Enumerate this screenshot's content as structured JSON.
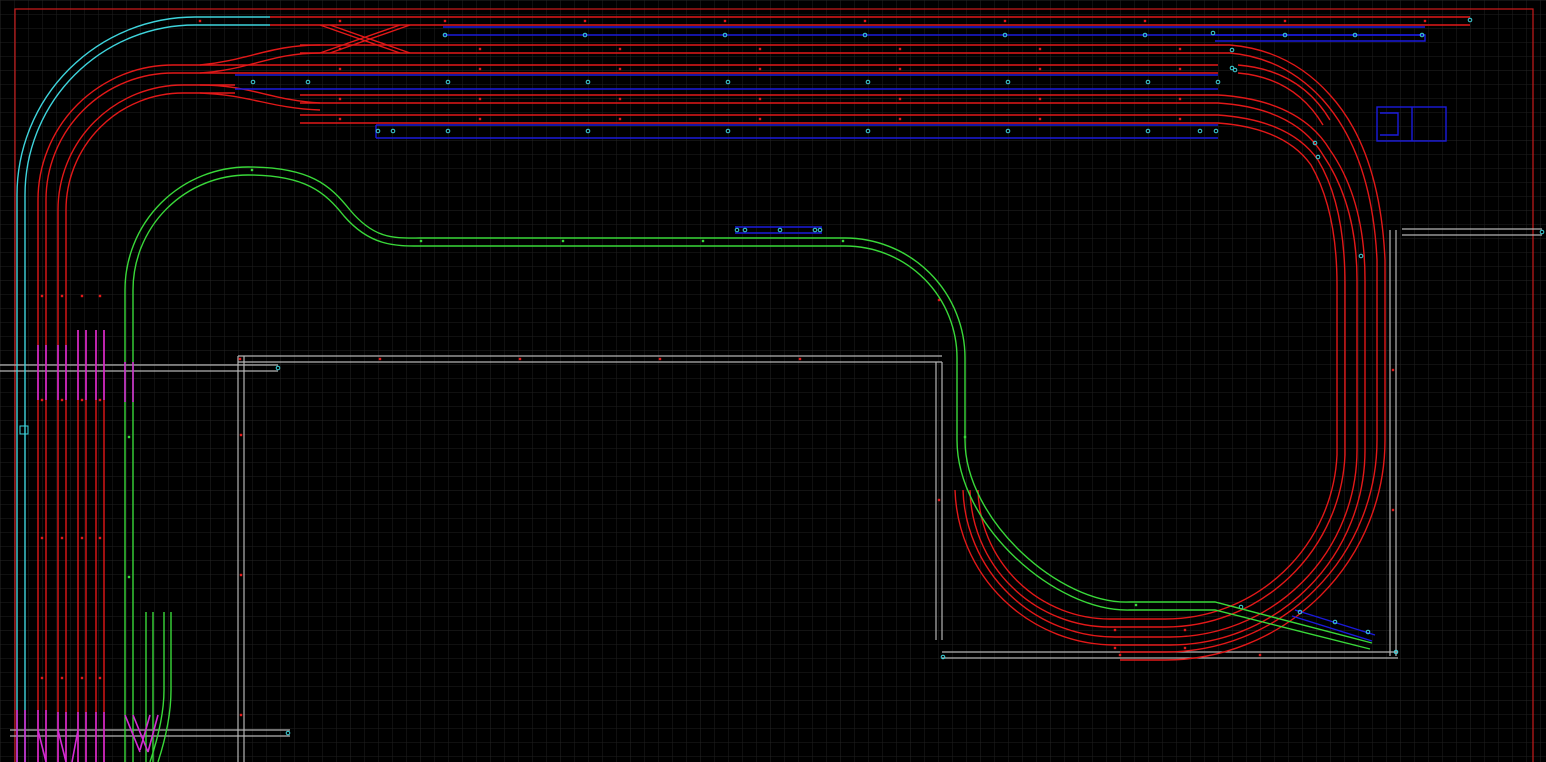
{
  "app": {
    "view": "track-plan-canvas"
  },
  "colors": {
    "background": "#000000",
    "grid": "#1e1e1e",
    "border": "#c81a1a",
    "red": "#e21818",
    "blue": "#1a1adc",
    "green": "#39d839",
    "cyan": "#3ed4dc",
    "magenta": "#d42cd4",
    "gray": "#b4b4b4"
  },
  "icons": {
    "track_segment": "track-segment-icon",
    "joint_marker": "track-joint-icon",
    "turnout": "turnout-icon",
    "baseboard": "baseboard-outline-icon"
  },
  "layers": [
    {
      "id": "main-loop",
      "color": "red"
    },
    {
      "id": "yard-sidings",
      "color": "blue"
    },
    {
      "id": "branch-line",
      "color": "green"
    },
    {
      "id": "inner-curve",
      "color": "cyan"
    },
    {
      "id": "staging-ladder",
      "color": "magenta"
    },
    {
      "id": "baseboards",
      "color": "gray"
    }
  ]
}
